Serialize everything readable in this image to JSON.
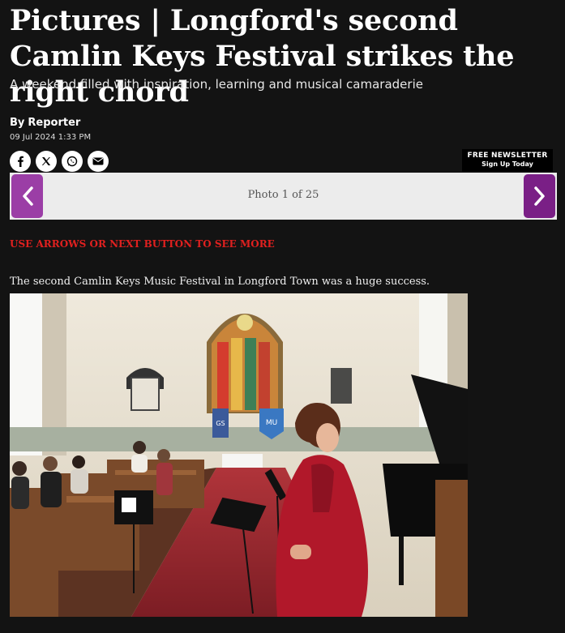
{
  "article": {
    "headline": "Pictures | Longford's second Camlin Keys Festival strikes the right chord",
    "subhead": "A weekend filled with inspiration, learning and musical camaraderie",
    "byline_prefix": "By",
    "author": "Reporter",
    "date": "09 Jul 2024 1:33 PM"
  },
  "share": {
    "icons": [
      "facebook-icon",
      "x-icon",
      "whatsapp-icon",
      "email-icon"
    ]
  },
  "newsletter": {
    "line1": "FREE NEWSLETTER",
    "line2": "Sign Up Today"
  },
  "gallery": {
    "counter": "Photo 1 of 25",
    "cta": "USE ARROWS OR NEXT BUTTON TO SEE MORE",
    "caption": "The second Camlin Keys Music Festival in Longford Town was a huge success.",
    "arrow_color": "#7a1f86"
  },
  "photo_banners": [
    "GS",
    "MU"
  ]
}
